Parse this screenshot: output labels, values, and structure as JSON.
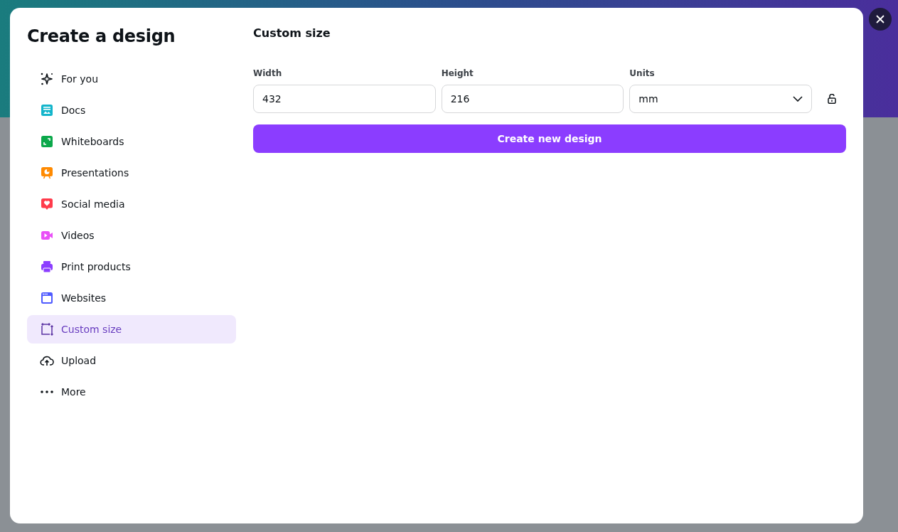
{
  "dialog": {
    "title": "Create a design"
  },
  "sidebar": {
    "items": [
      {
        "label": "For you",
        "selected": false
      },
      {
        "label": "Docs",
        "selected": false
      },
      {
        "label": "Whiteboards",
        "selected": false
      },
      {
        "label": "Presentations",
        "selected": false
      },
      {
        "label": "Social media",
        "selected": false
      },
      {
        "label": "Videos",
        "selected": false
      },
      {
        "label": "Print products",
        "selected": false
      },
      {
        "label": "Websites",
        "selected": false
      },
      {
        "label": "Custom size",
        "selected": true
      },
      {
        "label": "Upload",
        "selected": false
      },
      {
        "label": "More",
        "selected": false
      }
    ]
  },
  "custom_size": {
    "heading": "Custom size",
    "fields": [
      {
        "kind": "text",
        "label": "Width",
        "value": "432"
      },
      {
        "kind": "text",
        "label": "Height",
        "value": "216"
      },
      {
        "kind": "select",
        "label": "Units",
        "value": "mm"
      }
    ],
    "button": "Create new design"
  }
}
